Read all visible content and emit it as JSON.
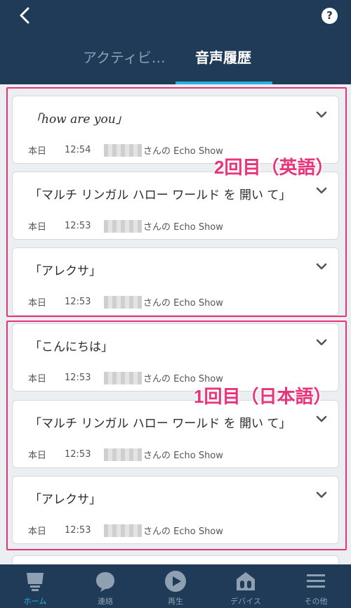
{
  "header": {
    "help_label": "?",
    "tabs": [
      {
        "label": "アクティビ…",
        "active": false
      },
      {
        "label": "音声履歴",
        "active": true
      }
    ]
  },
  "annotations": {
    "english_label": "2回目（英語）",
    "japanese_label": "1回目（日本語）",
    "frame_color": "#e9337a"
  },
  "items": [
    {
      "utterance": "「how are you」",
      "day": "本日",
      "time": "12:54",
      "device": "さんの Echo Show"
    },
    {
      "utterance": "「マルチ リンガル ハロー ワールド を 開い て」",
      "day": "本日",
      "time": "12:53",
      "device": "さんの Echo Show"
    },
    {
      "utterance": "「アレクサ」",
      "day": "本日",
      "time": "12:53",
      "device": "さんの Echo Show"
    },
    {
      "utterance": "「こんにちは」",
      "day": "本日",
      "time": "12:53",
      "device": "さんの Echo Show"
    },
    {
      "utterance": "「マルチ リンガル ハロー ワールド を 開い て」",
      "day": "本日",
      "time": "12:53",
      "device": "さんの Echo Show"
    },
    {
      "utterance": "「アレクサ」",
      "day": "本日",
      "time": "12:53",
      "device": "さんの Echo Show"
    }
  ],
  "bottom_nav": [
    {
      "label": "ホーム",
      "icon": "home-icon",
      "active": true
    },
    {
      "label": "連絡",
      "icon": "chat-bubble-icon",
      "active": false
    },
    {
      "label": "再生",
      "icon": "play-icon",
      "active": false
    },
    {
      "label": "デバイス",
      "icon": "devices-icon",
      "active": false
    },
    {
      "label": "その他",
      "icon": "menu-icon",
      "active": false
    }
  ],
  "colors": {
    "header_bg": "#1f3b57",
    "accent": "#2cb0e0",
    "annotation": "#e9337a"
  }
}
